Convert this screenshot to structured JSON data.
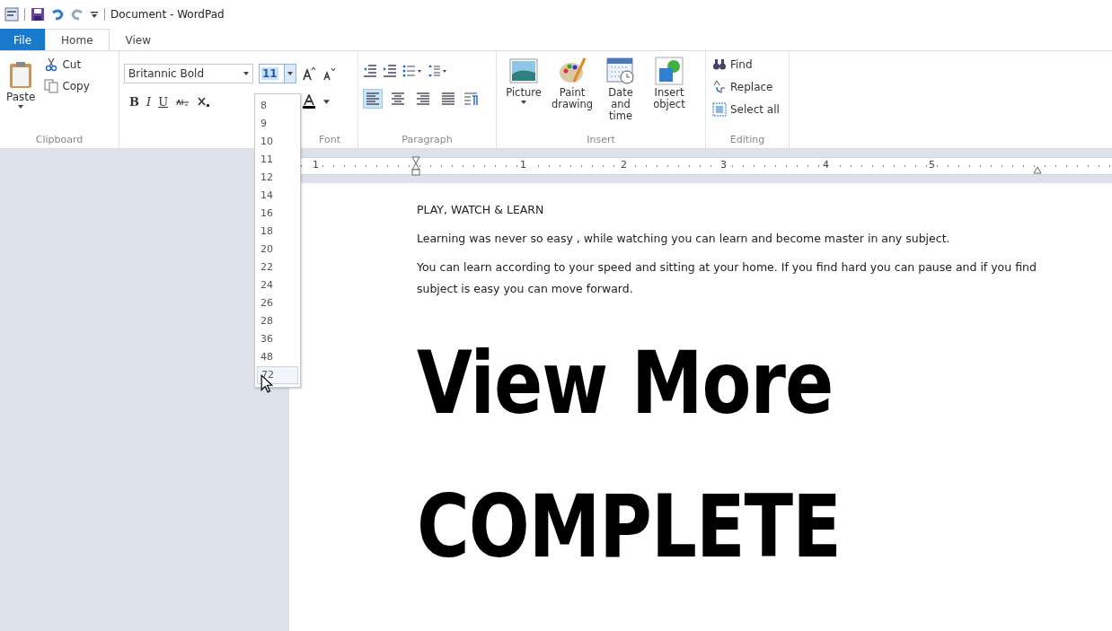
{
  "window": {
    "title": "Document - WordPad"
  },
  "tabs": [
    {
      "label": "File",
      "kind": "file",
      "selected": false
    },
    {
      "label": "Home",
      "kind": "tab",
      "selected": true
    },
    {
      "label": "View",
      "kind": "tab",
      "selected": false
    }
  ],
  "clipboard": {
    "paste": "Paste",
    "cut": "Cut",
    "copy": "Copy",
    "label": "Clipboard"
  },
  "font": {
    "font_name": "Britannic Bold",
    "font_size": "11",
    "format_buttons": [
      "B",
      "I",
      "U"
    ],
    "label": "Font"
  },
  "paragraph": {
    "alignments": [
      {
        "selected": true
      },
      {
        "selected": false
      },
      {
        "selected": false
      },
      {
        "selected": false
      }
    ],
    "label": "Paragraph"
  },
  "insert": {
    "buttons": [
      {
        "label": "Picture",
        "kind": "picture",
        "dropdown": true
      },
      {
        "label": "Paint drawing",
        "kind": "paint",
        "dropdown": false
      },
      {
        "label": "Date and time",
        "kind": "calendar",
        "dropdown": false
      },
      {
        "label": "Insert object",
        "kind": "object",
        "dropdown": false
      }
    ],
    "label": "Insert"
  },
  "editing": {
    "items": [
      {
        "label": "Find",
        "kind": "find"
      },
      {
        "label": "Replace",
        "kind": "replace"
      },
      {
        "label": "Select all",
        "kind": "selectall"
      }
    ],
    "label": "Editing"
  },
  "font_size_dropdown": {
    "items": [
      {
        "label": "8",
        "selected": false
      },
      {
        "label": "9",
        "selected": false
      },
      {
        "label": "10",
        "selected": false
      },
      {
        "label": "11",
        "selected": false
      },
      {
        "label": "12",
        "selected": false
      },
      {
        "label": "14",
        "selected": false
      },
      {
        "label": "16",
        "selected": false
      },
      {
        "label": "18",
        "selected": false
      },
      {
        "label": "20",
        "selected": false
      },
      {
        "label": "22",
        "selected": false
      },
      {
        "label": "24",
        "selected": false
      },
      {
        "label": "26",
        "selected": false
      },
      {
        "label": "28",
        "selected": false
      },
      {
        "label": "36",
        "selected": false
      },
      {
        "label": "48",
        "selected": false
      },
      {
        "label": "72",
        "selected": true
      }
    ]
  },
  "ruler": {
    "labels": [
      "1",
      "1",
      "2",
      "3",
      "4",
      "5"
    ]
  },
  "document": {
    "paragraphs": [
      {
        "kind": "body",
        "text": "PLAY, WATCH & LEARN"
      },
      {
        "kind": "body",
        "text": "Learning was never so easy , while watching you can learn and become master in any subject."
      },
      {
        "kind": "body",
        "text": "You can learn according to your speed and sitting at your home. If you find hard you can pause and if you find subject is easy you can move forward."
      },
      {
        "kind": "heading",
        "text": "View More"
      },
      {
        "kind": "heading",
        "text": "COMPLETE"
      }
    ]
  }
}
